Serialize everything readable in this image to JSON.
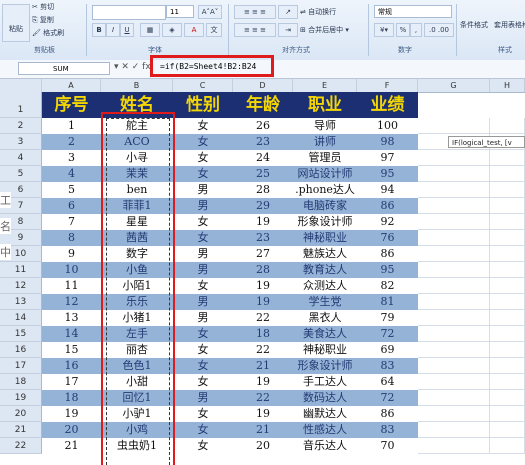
{
  "ribbon": {
    "clipboard": {
      "paste": "粘贴",
      "cut": "剪切",
      "copy": "复制",
      "format_painter": "格式刷",
      "group": "剪贴板"
    },
    "font": {
      "size": "11",
      "bold": "B",
      "italic": "I",
      "underline": "U",
      "group": "字体"
    },
    "alignment": {
      "wrap": "自动换行",
      "merge": "合并后居中",
      "group": "对齐方式"
    },
    "number": {
      "format": "常规",
      "percent": "%",
      "group": "数字"
    },
    "styles": {
      "cond": "条件格式",
      "table": "套用表格格式",
      "group": "样式"
    }
  },
  "formula_bar": {
    "name_box": "SUM",
    "buttons": "▾ ✕ ✓ fx",
    "formula": "=if(B2=Sheet4!B2:B24"
  },
  "tooltip": "IF(logical_test, [v",
  "columns": [
    "A",
    "B",
    "C",
    "D",
    "E",
    "F",
    "G",
    "H"
  ],
  "headers": [
    "序号",
    "姓名",
    "性别",
    "年龄",
    "职业",
    "业绩"
  ],
  "rows": [
    [
      "1",
      "舵主",
      "女",
      "26",
      "导师",
      "100"
    ],
    [
      "2",
      "ACO",
      "女",
      "23",
      "讲师",
      "98"
    ],
    [
      "3",
      "小寻",
      "女",
      "24",
      "管理员",
      "97"
    ],
    [
      "4",
      "茉茉",
      "女",
      "25",
      "网站设计师",
      "95"
    ],
    [
      "5",
      "ben",
      "男",
      "28",
      ".phone达人",
      "94"
    ],
    [
      "6",
      "菲菲1",
      "男",
      "29",
      "电脑砖家",
      "86"
    ],
    [
      "7",
      "星星",
      "女",
      "19",
      "形象设计师",
      "92"
    ],
    [
      "8",
      "茜茜",
      "女",
      "23",
      "神秘职业",
      "76"
    ],
    [
      "9",
      "数字",
      "男",
      "27",
      "魅族达人",
      "86"
    ],
    [
      "10",
      "小鱼",
      "男",
      "28",
      "教育达人",
      "95"
    ],
    [
      "11",
      "小陌1",
      "女",
      "19",
      "众测达人",
      "82"
    ],
    [
      "12",
      "乐乐",
      "男",
      "19",
      "学生党",
      "81"
    ],
    [
      "13",
      "小猪1",
      "男",
      "22",
      "黑衣人",
      "79"
    ],
    [
      "14",
      "左手",
      "女",
      "18",
      "美食达人",
      "72"
    ],
    [
      "15",
      "丽杏",
      "女",
      "22",
      "神秘职业",
      "69"
    ],
    [
      "16",
      "色色1",
      "女",
      "21",
      "形象设计师",
      "83"
    ],
    [
      "17",
      "小甜",
      "女",
      "19",
      "手工达人",
      "64"
    ],
    [
      "18",
      "回忆1",
      "男",
      "22",
      "数码达人",
      "72"
    ],
    [
      "19",
      "小驴1",
      "女",
      "19",
      "幽默达人",
      "86"
    ],
    [
      "20",
      "小鸡",
      "女",
      "21",
      "性感达人",
      "83"
    ],
    [
      "21",
      "虫虫奶1",
      "女",
      "20",
      "音乐达人",
      "70"
    ]
  ],
  "left_overlay": [
    "工",
    "名",
    "中"
  ],
  "colors": {
    "header_bg": "#1d2f73",
    "header_text": "#f4d600",
    "band_blue": "#95b3d7",
    "highlight_red": "#e01b1b"
  }
}
